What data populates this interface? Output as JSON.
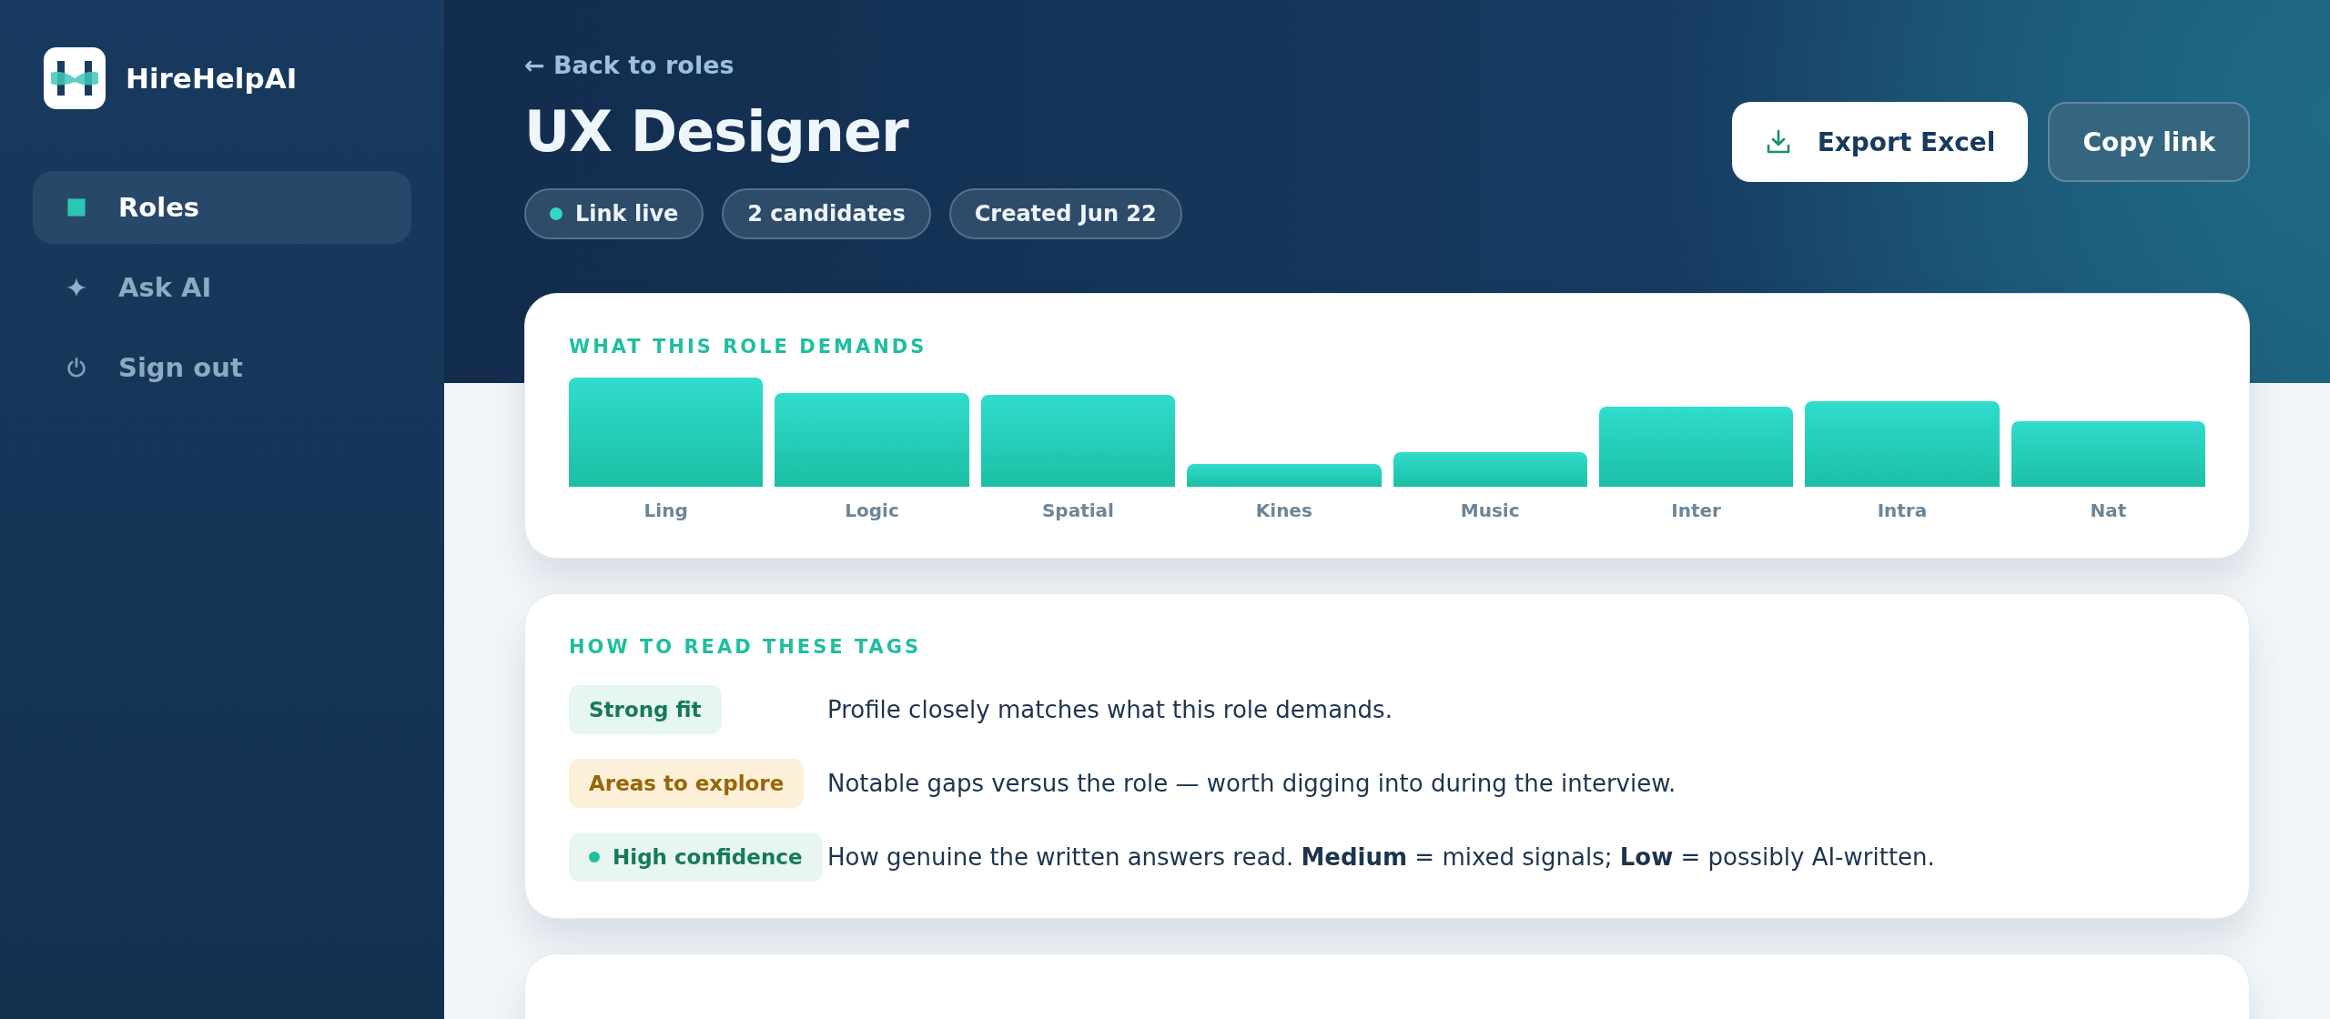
{
  "brand": {
    "name": "HireHelpAI"
  },
  "sidebar": {
    "items": [
      {
        "label": "Roles",
        "selected": true
      },
      {
        "label": "Ask AI",
        "selected": false
      },
      {
        "label": "Sign out",
        "selected": false
      }
    ]
  },
  "header": {
    "back_link": "← Back to roles",
    "title": "UX Designer",
    "chips": [
      {
        "label": "Link live",
        "live": true
      },
      {
        "label": "2 candidates",
        "live": false
      },
      {
        "label": "Created Jun 22",
        "live": false
      }
    ],
    "buttons": [
      {
        "label": "Export Excel",
        "kind": "primary"
      },
      {
        "label": "Copy link",
        "kind": "secondary"
      }
    ]
  },
  "demands": {
    "heading": "WHAT THIS ROLE DEMANDS",
    "bars": [
      {
        "label": "Ling"
      },
      {
        "label": "Logic"
      },
      {
        "label": "Spatial"
      },
      {
        "label": "Kines"
      },
      {
        "label": "Music"
      },
      {
        "label": "Inter"
      },
      {
        "label": "Intra"
      },
      {
        "label": "Nat"
      }
    ]
  },
  "legend": {
    "heading": "HOW TO READ THESE TAGS",
    "rows": [
      {
        "tag": "Strong fit",
        "kind": "fit",
        "description": "Profile closely matches what this role demands."
      },
      {
        "tag": "Areas to explore",
        "kind": "explore",
        "description": "Notable gaps versus the role — worth digging into during the interview."
      },
      {
        "tag": "High confidence",
        "kind": "confidence",
        "description": "How genuine the written answers read. **Medium** = mixed signals; **Low** = possibly AI-written."
      }
    ]
  }
}
